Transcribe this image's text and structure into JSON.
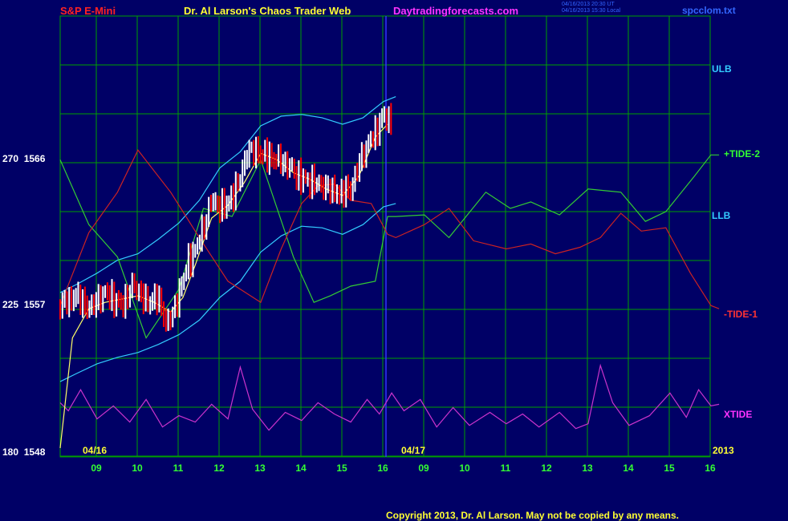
{
  "header": {
    "symbol": "S&P E-Mini",
    "title": "Dr. Al Larson's Chaos Trader Web",
    "site": "Daytradingforecasts.com",
    "timestamp_ut": "04/16/2013 20:30 UT",
    "timestamp_local": "04/16/2013 15:30 Local",
    "file": "spcclom.txt"
  },
  "copyright": "Copyright 2013, Dr. Al Larson. May not be copied by any means.",
  "colors": {
    "background": "#000066",
    "grid": "#00a000",
    "price_up": "#ffffff",
    "price_down": "#ff0000",
    "bands": "#33ccff",
    "tide2": "#33cc33",
    "tide1": "#cc2222",
    "xtide": "#cc33cc",
    "fast_line": "#ffff66"
  },
  "chart_data": {
    "type": "line",
    "y_labels": [
      {
        "left": "270",
        "price": "1566"
      },
      {
        "left": "225",
        "price": "1557"
      },
      {
        "left": "180",
        "price": "1548"
      }
    ],
    "x_ticks": [
      "09",
      "10",
      "11",
      "12",
      "13",
      "14",
      "15",
      "16",
      "09",
      "10",
      "11",
      "12",
      "13",
      "14",
      "15",
      "16"
    ],
    "date_labels": [
      "04/16",
      "04/17"
    ],
    "year_label": "2013",
    "series_labels": [
      "ULB",
      "+TIDE-2",
      "LLB",
      "-TIDE-1",
      "XTIDE"
    ],
    "ylim": [
      1548,
      1566
    ],
    "x_range": [
      8.1,
      24.2
    ],
    "series": [
      {
        "name": "price",
        "x": [
          8.1,
          8.5,
          8.8,
          9.2,
          9.6,
          9.9,
          10.2,
          10.5,
          10.7,
          10.9,
          11.2,
          11.5,
          11.8,
          12.1,
          12.4,
          12.7,
          13.0,
          13.3,
          13.6,
          14.0,
          14.3,
          14.6,
          14.9,
          15.2,
          15.5,
          15.8,
          16.0,
          16.2
        ],
        "y": [
          1557,
          1557.6,
          1556.8,
          1557.8,
          1557,
          1558.3,
          1557.2,
          1557.5,
          1555.8,
          1556.8,
          1559.5,
          1561,
          1563.5,
          1563,
          1564.2,
          1566.6,
          1566.4,
          1566.1,
          1565.8,
          1564.8,
          1564.6,
          1564.3,
          1563.9,
          1564.2,
          1566.4,
          1567.7,
          1568.7,
          1568.4
        ]
      },
      {
        "name": "ULB",
        "x": [
          8.1,
          8.5,
          9.0,
          9.5,
          10.0,
          10.5,
          11.0,
          11.5,
          12.0,
          12.5,
          13.0,
          13.5,
          14.0,
          14.5,
          15.0,
          15.5,
          16.0,
          16.3
        ],
        "y": [
          1557.8,
          1558.3,
          1559,
          1559.8,
          1560.2,
          1561.1,
          1562.1,
          1563.5,
          1565.5,
          1566.5,
          1568.1,
          1568.7,
          1568.8,
          1568.6,
          1568.2,
          1568.6,
          1569.6,
          1569.9
        ]
      },
      {
        "name": "LLB",
        "x": [
          8.1,
          8.5,
          9.0,
          9.5,
          10.0,
          10.5,
          11.0,
          11.5,
          12.0,
          12.5,
          13.0,
          13.5,
          14.0,
          14.5,
          15.0,
          15.5,
          16.0,
          16.3
        ],
        "y": [
          1552.3,
          1552.8,
          1553.4,
          1553.8,
          1554.1,
          1554.6,
          1555.2,
          1556.1,
          1557.5,
          1558.5,
          1560.3,
          1561.3,
          1561.9,
          1561.8,
          1561.4,
          1562,
          1563.1,
          1563.3
        ]
      },
      {
        "name": "+TIDE-2",
        "x": [
          8.1,
          8.8,
          9.5,
          10.2,
          11.0,
          11.6,
          12.3,
          13.0,
          13.8,
          14.3,
          14.7,
          15.2,
          15.8,
          16.1,
          16.3,
          17.0,
          17.6,
          18.5,
          19.1,
          19.6,
          20.3,
          21.0,
          21.8,
          22.4,
          22.9,
          23.6,
          24.0,
          24.2
        ],
        "y": [
          1566,
          1562,
          1560,
          1555,
          1558,
          1563,
          1562.5,
          1566,
          1560,
          1557.2,
          1557.6,
          1558.2,
          1558.5,
          1562.5,
          1562.5,
          1562.6,
          1561.2,
          1564,
          1563,
          1563.4,
          1562.6,
          1564.2,
          1564,
          1562.2,
          1562.8,
          1565,
          1566.3,
          1566.3
        ]
      },
      {
        "name": "-TIDE-1",
        "x": [
          8.1,
          8.8,
          9.5,
          10.0,
          10.8,
          11.5,
          12.2,
          13.0,
          13.5,
          14.0,
          14.4,
          14.8,
          15.2,
          15.7,
          16.1,
          16.3,
          17.0,
          17.6,
          18.2,
          19.0,
          19.6,
          20.2,
          20.8,
          21.3,
          21.8,
          22.3,
          22.9,
          23.5,
          24.0,
          24.2
        ],
        "y": [
          1557,
          1561.5,
          1564,
          1566.6,
          1564,
          1561.2,
          1558.5,
          1557.2,
          1560.5,
          1563.3,
          1564.4,
          1564.5,
          1563.5,
          1563.3,
          1561.4,
          1561.2,
          1562,
          1563,
          1561,
          1560.5,
          1560.8,
          1560.2,
          1560.6,
          1561.2,
          1562.7,
          1561.6,
          1561.8,
          1559,
          1557,
          1556.8
        ]
      },
      {
        "name": "XTIDE",
        "x": [
          8.1,
          8.3,
          8.6,
          9.0,
          9.4,
          9.8,
          10.2,
          10.6,
          11.0,
          11.4,
          11.8,
          12.2,
          12.5,
          12.8,
          13.2,
          13.6,
          14.0,
          14.4,
          14.8,
          15.2,
          15.6,
          15.9,
          16.2,
          16.5,
          16.9,
          17.3,
          17.7,
          18.1,
          18.6,
          19.0,
          19.4,
          19.8,
          20.3,
          20.7,
          21.0,
          21.3,
          21.6,
          22.0,
          22.5,
          23.0,
          23.4,
          23.7,
          24.0,
          24.2
        ],
        "y": [
          1551,
          1550.5,
          1551.8,
          1550,
          1550.8,
          1549.8,
          1551.2,
          1549.5,
          1550.2,
          1549.8,
          1550.9,
          1550,
          1553.2,
          1550.6,
          1549.3,
          1550.4,
          1549.9,
          1551,
          1550.3,
          1549.8,
          1551.2,
          1550.3,
          1551.6,
          1550.5,
          1551.2,
          1549.5,
          1550.7,
          1549.6,
          1550.4,
          1549.7,
          1550.3,
          1549.5,
          1550.4,
          1549.4,
          1549.7,
          1553.3,
          1551,
          1549.6,
          1550.2,
          1551.6,
          1550.1,
          1551.8,
          1550.8,
          1550.9
        ]
      },
      {
        "name": "fast",
        "x": [
          8.1,
          8.4,
          8.8,
          9.2,
          9.6,
          10.0,
          10.4,
          10.8,
          11.1,
          11.4,
          11.8,
          12.2,
          12.6,
          13.0,
          13.4,
          13.8,
          14.2,
          14.6,
          15.0,
          15.4,
          15.8,
          16.1
        ],
        "y": [
          1548.2,
          1555,
          1556.8,
          1557.2,
          1557.4,
          1557.6,
          1557.2,
          1556.6,
          1557.5,
          1559.5,
          1562.4,
          1563.2,
          1564.6,
          1566.4,
          1566,
          1565.2,
          1564.8,
          1564.2,
          1563.8,
          1565,
          1567.4,
          1568.2
        ]
      }
    ]
  }
}
